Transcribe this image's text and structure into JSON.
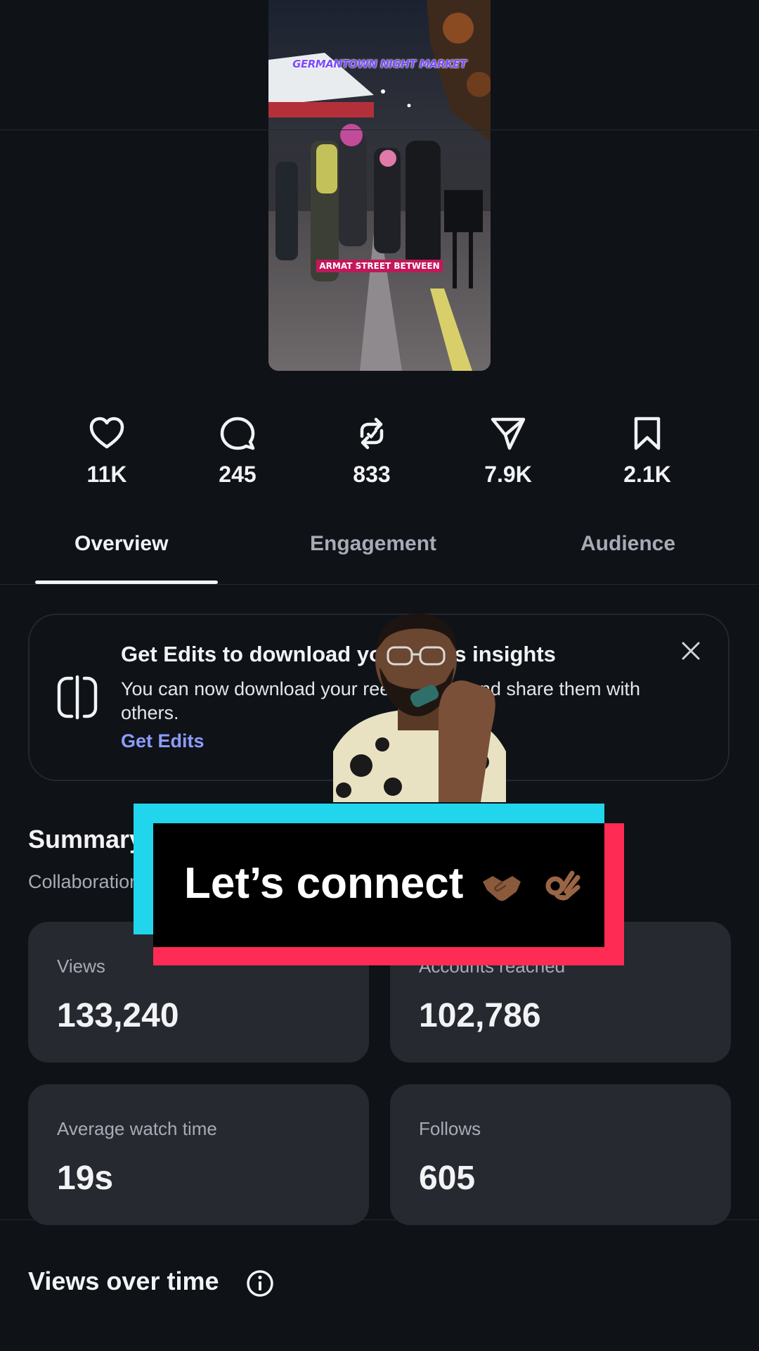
{
  "video": {
    "caption_top": "GERMANTOWN NIGHT MARKET",
    "caption_mid": "ARMAT STREET BETWEEN"
  },
  "stats": [
    {
      "icon": "heart-icon",
      "value": "11K"
    },
    {
      "icon": "comment-icon",
      "value": "245"
    },
    {
      "icon": "repost-icon",
      "value": "833"
    },
    {
      "icon": "share-icon",
      "value": "7.9K"
    },
    {
      "icon": "bookmark-icon",
      "value": "2.1K"
    }
  ],
  "tabs": [
    {
      "label": "Overview",
      "active": true
    },
    {
      "label": "Engagement",
      "active": false
    },
    {
      "label": "Audience",
      "active": false
    }
  ],
  "promo": {
    "title": "Get Edits to download your reel’s insights",
    "description": "You can now download your reel insights and share them with others.",
    "link": "Get Edits"
  },
  "summary": {
    "title": "Summary",
    "subtitle": "Collaboration",
    "cards": [
      {
        "label": "Views",
        "value": "133,240"
      },
      {
        "label": "Accounts reached",
        "value": "102,786"
      },
      {
        "label": "Average watch time",
        "value": "19s"
      },
      {
        "label": "Follows",
        "value": "605"
      }
    ]
  },
  "views_over_time": {
    "title": "Views over time"
  },
  "overlay": {
    "banner_text": "Let’s connect",
    "emojis": [
      "handshake-emoji",
      "ok-hand-emoji"
    ]
  },
  "colors": {
    "background": "#0f1217",
    "card": "#262930",
    "link": "#8c9cff",
    "banner_cyan": "#20d5ec",
    "banner_red": "#fe2c55"
  }
}
